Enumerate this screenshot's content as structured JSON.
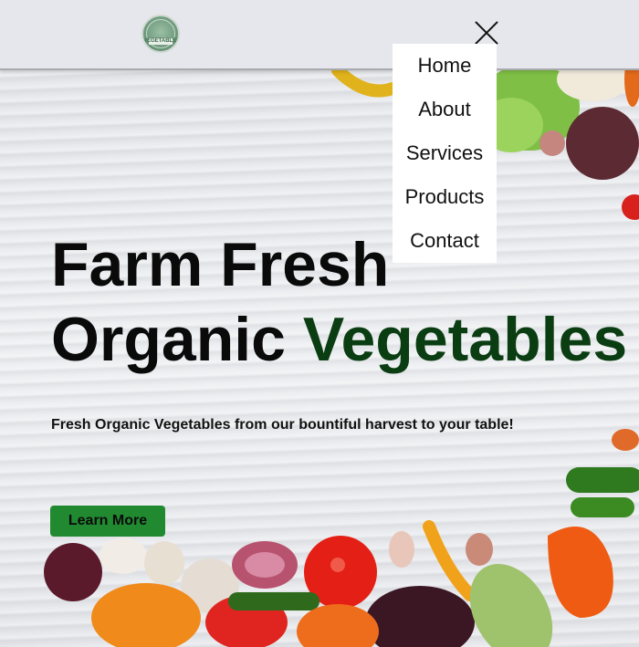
{
  "header": {
    "logo_text": "VEGETABLES"
  },
  "menu": {
    "items": [
      "Home",
      "About",
      "Services",
      "Products",
      "Contact"
    ]
  },
  "hero": {
    "headline_line1": "Farm Fresh",
    "headline_line2_plain": "Organic ",
    "headline_line2_accent": "Vegetables",
    "subtitle": "Fresh Organic Vegetables from our bountiful harvest to your table!",
    "cta_label": "Learn More"
  },
  "colors": {
    "accent_green_text": "#0b3d12",
    "cta_green": "#218a31"
  }
}
